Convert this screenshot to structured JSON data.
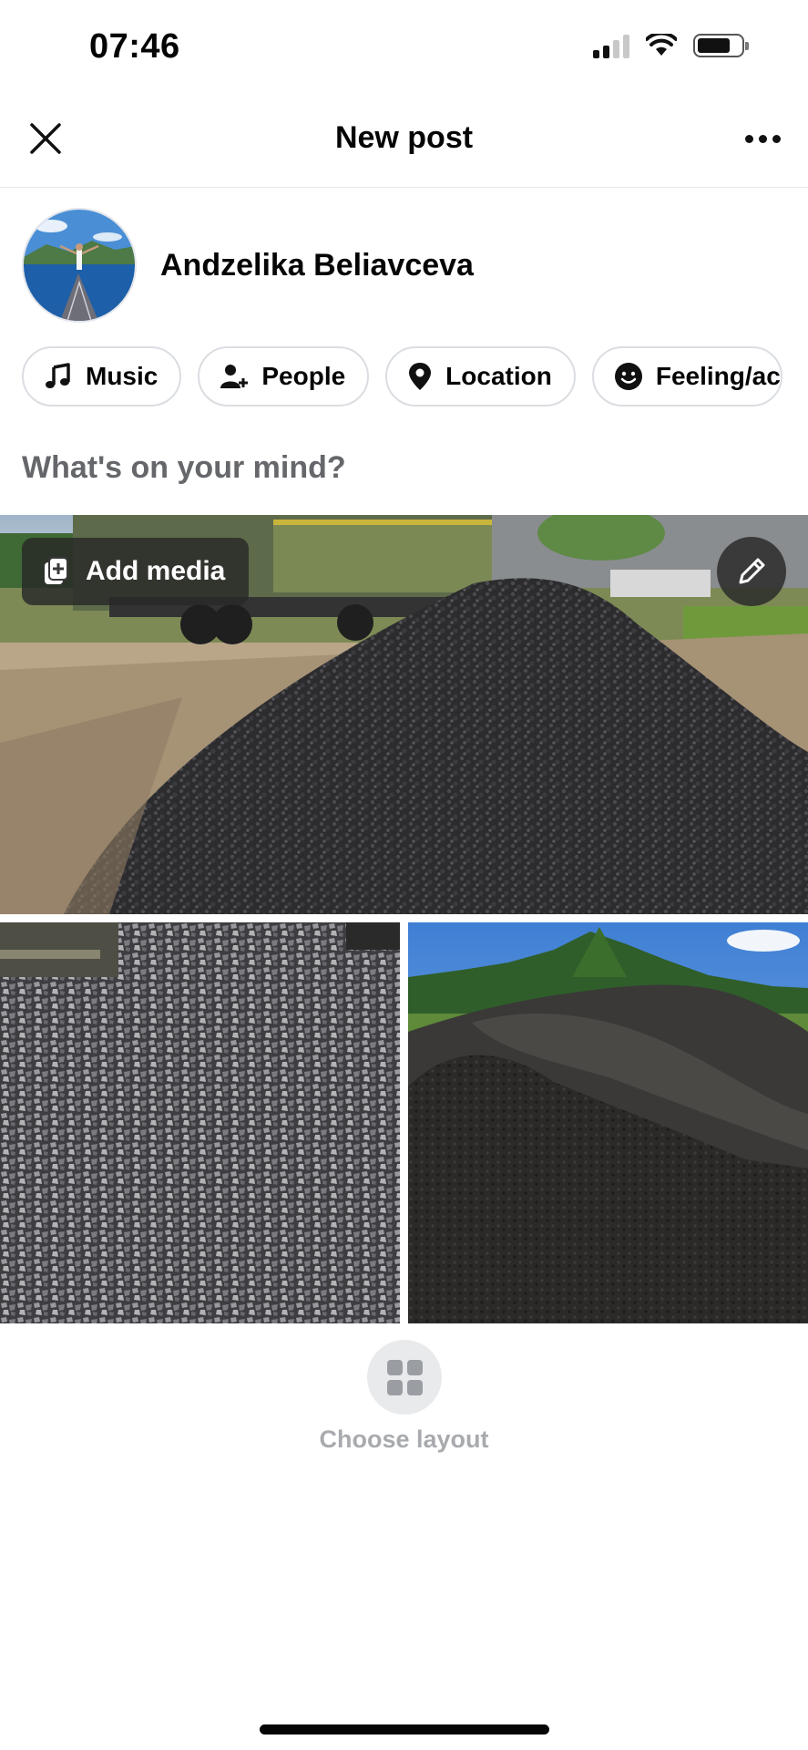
{
  "status_bar": {
    "time": "07:46",
    "battery_percent": 75
  },
  "header": {
    "title": "New post",
    "close_icon": "close-icon",
    "more_icon": "more-horizontal-icon"
  },
  "author": {
    "name": "Andzelika Beliavceva"
  },
  "chips": [
    {
      "label": "Music",
      "icon": "music-note-icon"
    },
    {
      "label": "People",
      "icon": "person-add-icon"
    },
    {
      "label": "Location",
      "icon": "location-pin-icon"
    },
    {
      "label": "Feeling/ac",
      "icon": "smiley-icon"
    }
  ],
  "composer": {
    "placeholder": "What's on your mind?"
  },
  "media": {
    "add_media_label": "Add media",
    "edit_icon": "pencil-icon",
    "photos": [
      "gravel-pile-truck",
      "gravel-closeup",
      "gravel-mounds-field"
    ]
  },
  "layout": {
    "label": "Choose layout",
    "icon": "grid-layout-icon"
  },
  "colors": {
    "text": "#050505",
    "secondary": "#65676b",
    "divider": "#e4e6eb",
    "muted": "#a8aaae"
  }
}
